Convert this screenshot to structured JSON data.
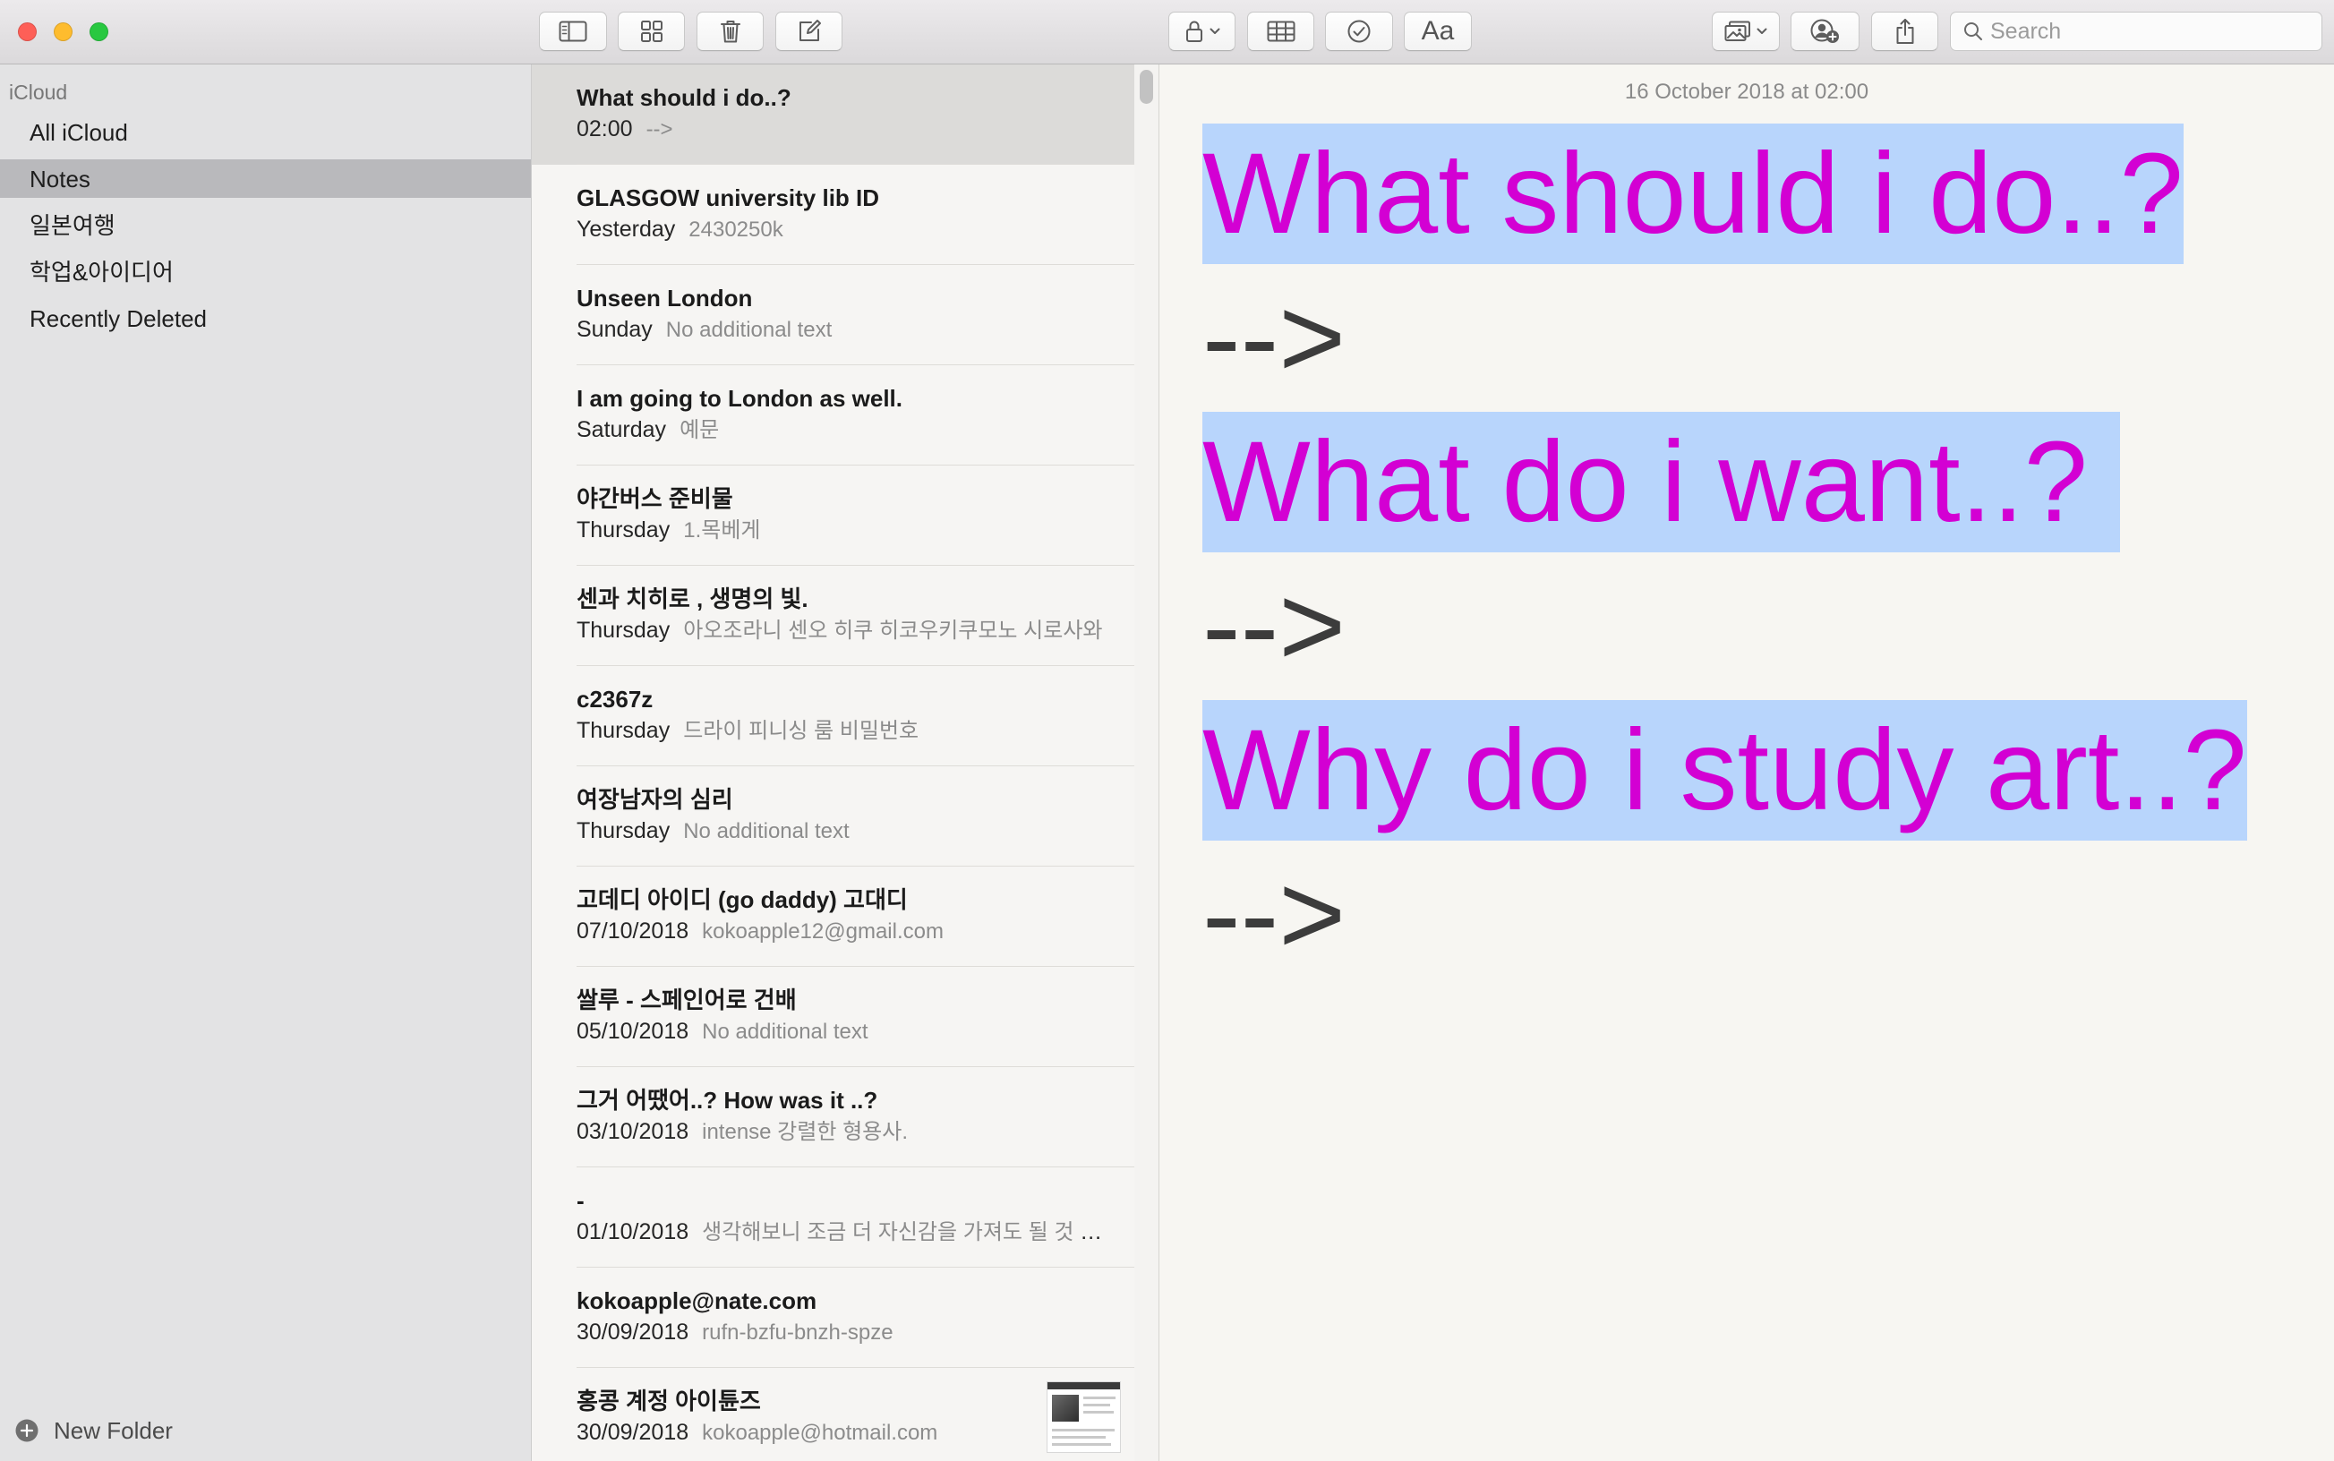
{
  "toolbar": {
    "window_controls": [
      "close-icon",
      "minimize-icon",
      "zoom-icon"
    ],
    "buttons": [
      "sidebar-toggle-icon",
      "gallery-view-icon",
      "trash-icon",
      "compose-icon",
      "lock-icon",
      "table-icon",
      "checklist-icon",
      "format-icon",
      "media-icon",
      "collaborate-icon",
      "share-icon"
    ],
    "format_button_label": "Aa",
    "search": {
      "placeholder": "Search",
      "value": ""
    }
  },
  "sidebar": {
    "account_title": "iCloud",
    "folders": [
      {
        "label": "All iCloud",
        "selected": false
      },
      {
        "label": "Notes",
        "selected": true
      },
      {
        "label": "일본여행",
        "selected": false
      },
      {
        "label": "학업&아이디어",
        "selected": false
      },
      {
        "label": "Recently Deleted",
        "selected": false
      }
    ],
    "new_folder_label": "New Folder",
    "new_folder_icon": "plus-circle-icon"
  },
  "note_list": {
    "notes": [
      {
        "title": "What should i do..?",
        "date": "02:00",
        "preview": "-->",
        "selected": true
      },
      {
        "title": "GLASGOW university lib ID",
        "date": "Yesterday",
        "preview": "2430250k"
      },
      {
        "title": "Unseen London",
        "date": "Sunday",
        "preview": "No additional text"
      },
      {
        "title": "I am going to London as well.",
        "date": "Saturday",
        "preview": "예문"
      },
      {
        "title": "야간버스 준비물",
        "date": "Thursday",
        "preview": "1.목베게"
      },
      {
        "title": "센과 치히로 , 생명의 빛.",
        "date": "Thursday",
        "preview": "아오조라니 센오 히쿠 히코우키쿠모노 시로사와"
      },
      {
        "title": "c2367z",
        "date": "Thursday",
        "preview": "드라이 피니싱 룸 비밀번호"
      },
      {
        "title": "여장남자의 심리",
        "date": "Thursday",
        "preview": "No additional text"
      },
      {
        "title": "고데디 아이디 (go daddy) 고대디",
        "date": "07/10/2018",
        "preview": "kokoapple12@gmail.com"
      },
      {
        "title": "쌀루 - 스페인어로 건배",
        "date": "05/10/2018",
        "preview": "No additional text"
      },
      {
        "title": "그거 어땠어..? How was it ..?",
        "date": "03/10/2018",
        "preview": "intense 강렬한 형용사."
      },
      {
        "title": "-",
        "date": "01/10/2018",
        "preview": "생각해보니 조금 더 자신감을 가져도 될 것 같…"
      },
      {
        "title": "kokoapple@nate.com",
        "date": "30/09/2018",
        "preview": "rufn-bzfu-bnzh-spze"
      },
      {
        "title": "홍콩 계정 아이튠즈",
        "date": "30/09/2018",
        "preview": "kokoapple@hotmail.com",
        "has_thumbnail": true
      }
    ]
  },
  "editor": {
    "timestamp": "16 October 2018 at 02:00",
    "lines": [
      {
        "text": "What should i do..?",
        "highlighted": true
      },
      {
        "text": "-->",
        "highlighted": false
      },
      {
        "text": "What do i want..? ",
        "highlighted": true
      },
      {
        "text": "-->",
        "highlighted": false
      },
      {
        "text": "Why do i study art..?",
        "highlighted": true
      },
      {
        "text": "-->",
        "highlighted": false
      }
    ]
  },
  "colors": {
    "close": "#fe5f57",
    "minimize": "#febc2e",
    "zoom": "#28c840",
    "note_text_magenta": "#d300d3",
    "selection_highlight": "#b8d5fc",
    "sidebar_selection": "#b9b9bc",
    "list_selection": "#dcdbd9"
  }
}
